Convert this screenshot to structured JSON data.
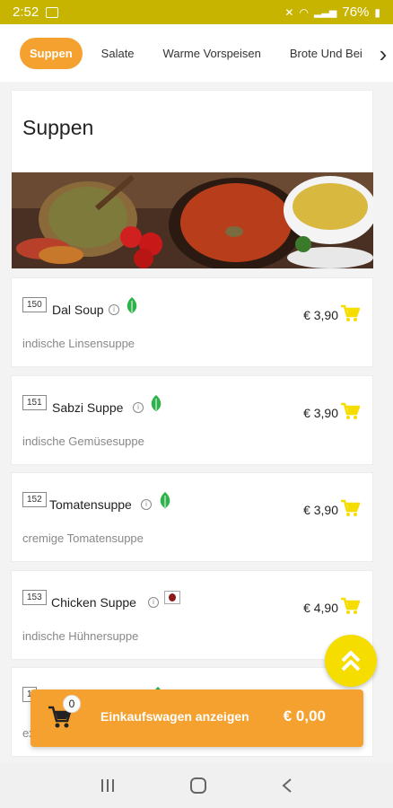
{
  "status_bar": {
    "time": "2:52",
    "battery": "76%"
  },
  "tabs": [
    {
      "label": "Suppen",
      "active": true
    },
    {
      "label": "Salate",
      "active": false
    },
    {
      "label": "Warme Vorspeisen",
      "active": false
    },
    {
      "label": "Brote Und Bei",
      "active": false
    }
  ],
  "section": {
    "title": "Suppen"
  },
  "items": [
    {
      "number": "150",
      "name": "Dal Soup",
      "description": "indische Linsensuppe",
      "price": "€ 3,90",
      "tag": "vegetarian-leaf-icon"
    },
    {
      "number": "151",
      "name": "Sabzi Suppe",
      "description": "indische Gemüsesuppe",
      "price": "€ 3,90",
      "tag": "vegetarian-leaf-icon"
    },
    {
      "number": "152",
      "name": "Tomatensuppe",
      "description": "cremige Tomatensuppe",
      "price": "€ 3,90",
      "tag": "vegetarian-leaf-icon"
    },
    {
      "number": "153",
      "name": "Chicken Suppe",
      "description": "indische Hühnersuppe",
      "price": "€ 4,90",
      "tag": "meat-icon"
    },
    {
      "number": "1",
      "name": "",
      "description": "ex",
      "price": "",
      "tag": "vegetarian-leaf-icon"
    }
  ],
  "cart": {
    "count": "0",
    "label": "Einkaufswagen anzeigen",
    "total": "€ 0,00"
  },
  "colors": {
    "status_bar": "#c7b400",
    "accent": "#f5a130",
    "cart_icon": "#f5dd00",
    "leaf": "#2eb24a"
  }
}
